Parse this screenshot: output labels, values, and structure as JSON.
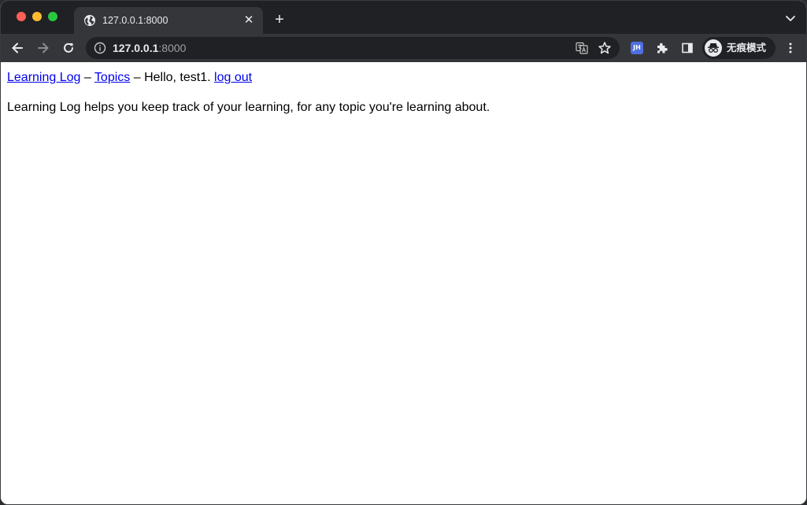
{
  "browser": {
    "tab": {
      "title": "127.0.0.1:8000"
    },
    "address": {
      "host": "127.0.0.1",
      "port": ":8000"
    },
    "extension_label": "JH",
    "profile_label": "无痕模式"
  },
  "page": {
    "nav": {
      "home_link": "Learning Log",
      "sep1": " – ",
      "topics_link": "Topics",
      "sep2": " – ",
      "greeting": "Hello, test1. ",
      "logout_link": "log out"
    },
    "intro": "Learning Log helps you keep track of your learning, for any topic you're learning about."
  },
  "colors": {
    "tab_strip_bg": "#202124",
    "toolbar_bg": "#35363a",
    "link": "#0000ee"
  }
}
